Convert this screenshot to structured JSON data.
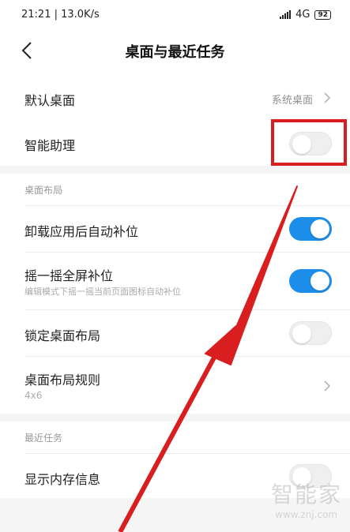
{
  "status_bar": {
    "time_speed": "21:21 | 13.0K/s",
    "network": "4G",
    "battery": "92"
  },
  "header": {
    "title": "桌面与最近任务"
  },
  "settings": {
    "default_desktop": {
      "label": "默认桌面",
      "value": "系统桌面"
    },
    "smart_assistant": {
      "label": "智能助理",
      "enabled": false
    }
  },
  "desktop_layout": {
    "section_title": "桌面布局",
    "auto_fill": {
      "label": "卸载应用后自动补位",
      "enabled": true
    },
    "shake_fill": {
      "label": "摇一摇全屏补位",
      "sublabel": "编辑模式下摇一摇当前页面图标自动补位",
      "enabled": true
    },
    "lock_layout": {
      "label": "锁定桌面布局",
      "enabled": false
    },
    "layout_rule": {
      "label": "桌面布局规则",
      "sublabel": "4x6"
    }
  },
  "recent_tasks": {
    "section_title": "最近任务",
    "show_memory": {
      "label": "显示内存信息",
      "enabled": false
    }
  },
  "watermark": {
    "text": "智能家",
    "url": "www.znj.com"
  },
  "colors": {
    "toggle_on": "#1c8de8",
    "annotation_red": "#d81e1e"
  }
}
